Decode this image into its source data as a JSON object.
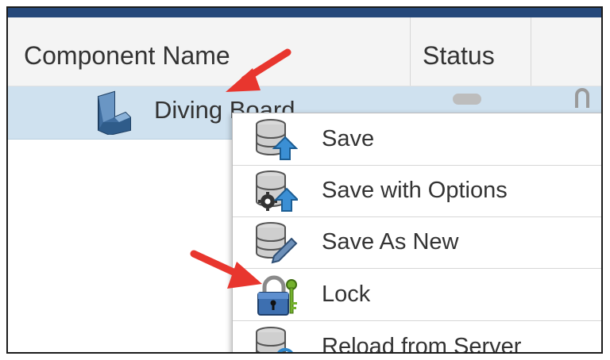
{
  "table": {
    "columns": [
      {
        "label": "Component Name"
      },
      {
        "label": "Status"
      }
    ],
    "rows": [
      {
        "name": "Diving Board",
        "icon": "solid-part-icon",
        "status": "status-chip",
        "lock_state": "lock-icon"
      }
    ]
  },
  "context_menu": {
    "items": [
      {
        "label": "Save",
        "icon": "database-upload-icon"
      },
      {
        "label": "Save with Options",
        "icon": "database-gear-upload-icon"
      },
      {
        "label": "Save As New",
        "icon": "database-pencil-icon"
      },
      {
        "label": "Lock",
        "icon": "padlock-key-icon"
      },
      {
        "label": "Reload from Server",
        "icon": "database-refresh-icon"
      }
    ]
  },
  "colors": {
    "header_bar": "#25487a",
    "selected_row": "#cfe1ef",
    "annotation_arrow": "#e8362e"
  }
}
